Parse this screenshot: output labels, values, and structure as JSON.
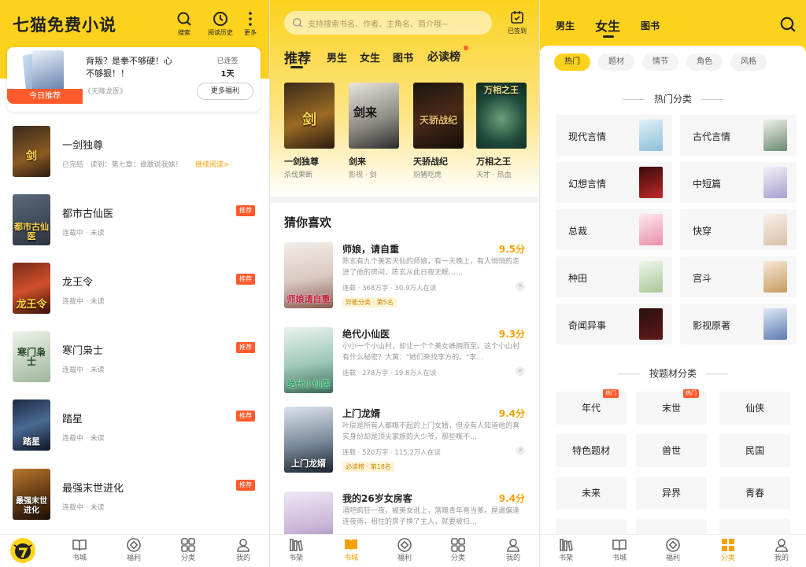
{
  "p1": {
    "app_title": "七猫免费小说",
    "top_buttons": [
      {
        "label": "搜索",
        "icon": "search-icon"
      },
      {
        "label": "阅读历史",
        "icon": "clock-icon"
      },
      {
        "label": "更多",
        "icon": "more-vertical-icon"
      }
    ],
    "promo": {
      "title": "背叛？是拳不够硬！心不够狠！！",
      "book": "《天降龙医》",
      "tag": "今日推荐",
      "signed_label": "已连签",
      "signed_days": "1天",
      "more_button": "更多福利"
    },
    "shelf": [
      {
        "title": "一剑独尊",
        "status": "已完结 · 读到：第七章：谁敢说我妹！",
        "continue": "继续阅读>",
        "badge": ""
      },
      {
        "title": "都市古仙医",
        "status": "连载中 · 未读",
        "badge": "推荐"
      },
      {
        "title": "龙王令",
        "status": "连载中 · 未读",
        "badge": "推荐"
      },
      {
        "title": "寒门枭士",
        "status": "连载中 · 未读",
        "badge": "推荐"
      },
      {
        "title": "踏星",
        "status": "连载中 · 未读",
        "badge": "推荐"
      },
      {
        "title": "最强末世进化",
        "status": "连载中 · 未读",
        "badge": "推荐"
      }
    ],
    "tabs": [
      {
        "label": "",
        "icon": "cat-logo-icon"
      },
      {
        "label": "书城",
        "icon": "book-open-icon"
      },
      {
        "label": "福利",
        "icon": "gift-diamond-icon"
      },
      {
        "label": "分类",
        "icon": "grid-icon"
      },
      {
        "label": "我的",
        "icon": "user-icon"
      }
    ]
  },
  "p2": {
    "search_placeholder": "支持搜索书名、作者、主角名、简介哦~",
    "signed": "已签到",
    "nav": [
      "推荐",
      "男生",
      "女生",
      "图书",
      "必读榜"
    ],
    "covers_text": [
      "剑",
      "剑来",
      "天骄战纪",
      "万相之王"
    ],
    "grid": [
      {
        "title": "一剑独尊",
        "sub": "杀伐果断"
      },
      {
        "title": "剑来",
        "sub": "影视 · 剑"
      },
      {
        "title": "天骄战纪",
        "sub": "扮猪吃虎"
      },
      {
        "title": "万相之王",
        "sub": "天才 · 热血"
      }
    ],
    "guess_title": "猜你喜欢",
    "list": [
      {
        "title": "师娘，请自重",
        "score": "9.5分",
        "desc": "陈玄有九个美若天仙的师娘，有一天晚上，有人悄悄的走进了他的房间，陈玄从此日夜无眠……",
        "meta": "连载 · 368万字 · 30.9万人在读",
        "tag": "异能分类 · 第5名",
        "cover_text": "师娘请自重"
      },
      {
        "title": "绝代小仙医",
        "score": "9.3分",
        "desc": "小小一个小山村，却让一个个美女蜂拥而至。这个小山村有什么秘密？大黄：\"她们来找李方的。\"李…",
        "meta": "连载 · 278万字 · 19.8万人在读",
        "tag": "",
        "cover_text": "绝代小仙医"
      },
      {
        "title": "上门龙婿",
        "score": "9.4分",
        "desc": "叶辰是所有人都瞧不起的上门女婿，但没有人知道他的真实身份却是顶尖家族的大少爷，那些瞧不…",
        "meta": "连载 · 520万字 · 115.2万人在读",
        "tag": "必读榜 · 第18名",
        "cover_text": "上门龙婿"
      },
      {
        "title": "我的26岁女房客",
        "score": "9.4分",
        "desc": "酒吧疯狂一夜，被美女讹上，落魄青年喜当爹。屋漏偏逢连夜雨，租住的房子换了主人，就要被扫…",
        "meta": "",
        "tag": "",
        "cover_text": ""
      }
    ],
    "tabs": [
      {
        "label": "书架",
        "icon": "shelf-icon"
      },
      {
        "label": "书城",
        "icon": "book-open-icon"
      },
      {
        "label": "福利",
        "icon": "gift-diamond-icon"
      },
      {
        "label": "分类",
        "icon": "grid-icon"
      },
      {
        "label": "我的",
        "icon": "user-icon"
      }
    ]
  },
  "p3": {
    "nav": [
      "男生",
      "女生",
      "图书"
    ],
    "pills": [
      "热门",
      "题材",
      "情节",
      "角色",
      "风格"
    ],
    "hot_title": "热门分类",
    "cats": [
      "现代言情",
      "古代言情",
      "幻想言情",
      "中短篇",
      "总裁",
      "快穿",
      "种田",
      "宫斗",
      "奇闻异事",
      "影视原著"
    ],
    "theme_title": "按题材分类",
    "themes": [
      "年代",
      "末世",
      "仙侠",
      "特色题材",
      "兽世",
      "民国",
      "未来",
      "异界",
      "青春"
    ],
    "hot_badge": "热门",
    "tabs": [
      {
        "label": "书架",
        "icon": "shelf-icon"
      },
      {
        "label": "书城",
        "icon": "book-open-icon"
      },
      {
        "label": "福利",
        "icon": "gift-diamond-icon"
      },
      {
        "label": "分类",
        "icon": "grid-icon"
      },
      {
        "label": "我的",
        "icon": "user-icon"
      }
    ]
  },
  "colors": {
    "brand_yellow": "#fdd21c",
    "accent_orange": "#f5a000",
    "badge_red": "#ff5a2b"
  }
}
